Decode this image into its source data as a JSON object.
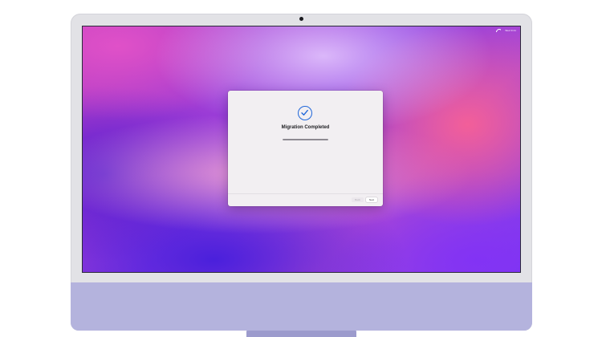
{
  "menubar": {
    "wifi_icon": "wifi-icon",
    "clock": "Wed 9:41"
  },
  "dialog": {
    "status_icon": "checkmark-circle-icon",
    "title": "Migration Completed",
    "progress": 1.0,
    "buttons": {
      "back_label": "Back",
      "next_label": "Next"
    }
  },
  "colors": {
    "accent": "#1f66d9",
    "chin": "#b4b3dd",
    "frame": "#e2e2e6"
  }
}
